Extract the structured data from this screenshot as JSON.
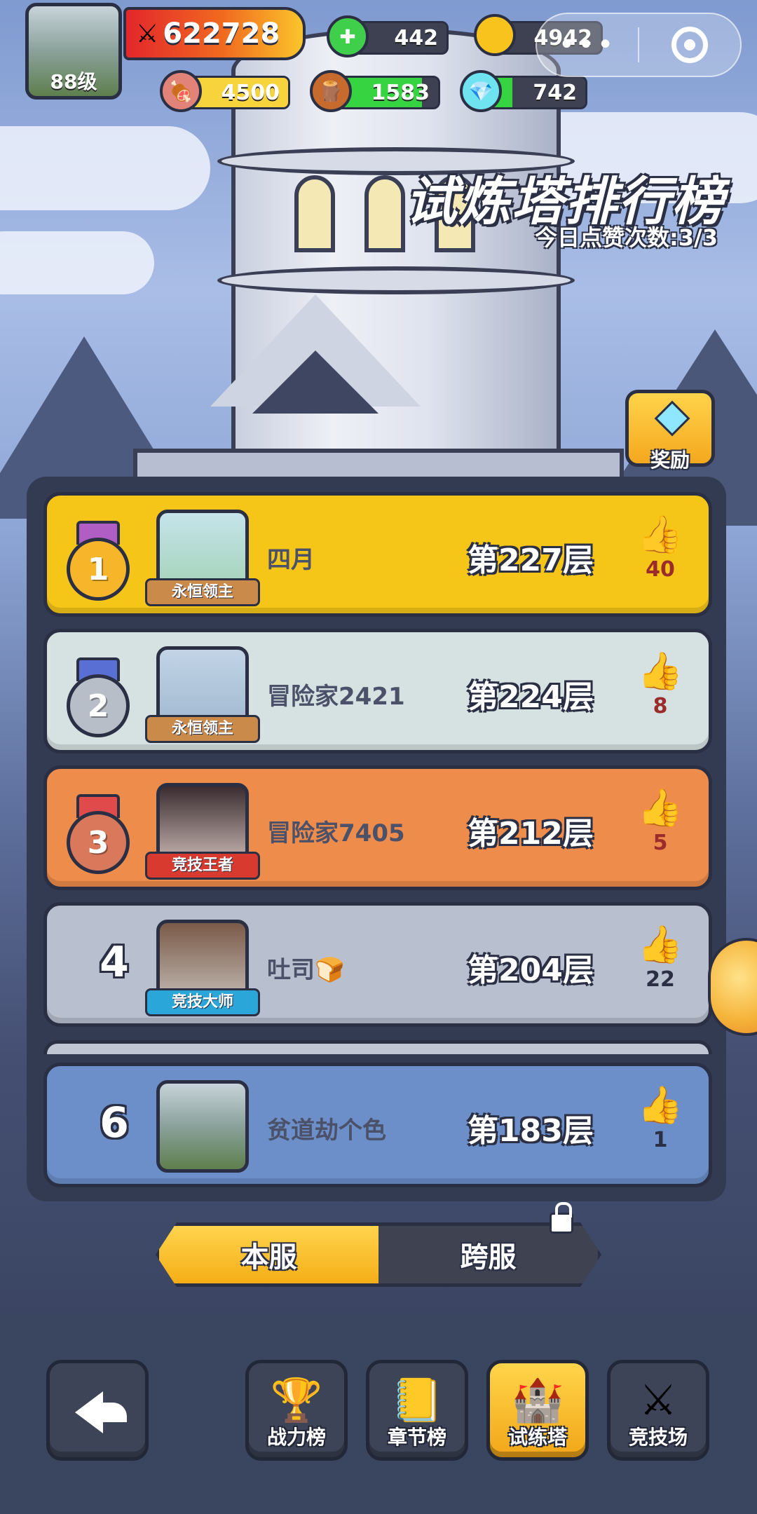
{
  "player": {
    "level": "88级",
    "power": "622728"
  },
  "resources": {
    "gems": "442",
    "gold": "4942",
    "meat": "4500",
    "wood": "1583",
    "crystal": "742"
  },
  "capsule": {
    "menu_dots": "•••"
  },
  "header": {
    "title": "试炼塔排行榜",
    "likes_today": "今日点赞次数:3/3",
    "reward_label": "奖励"
  },
  "rankings": [
    {
      "rank": "1",
      "name": "四月",
      "floor": "第227层",
      "likes": "40",
      "badge": "永恒领主"
    },
    {
      "rank": "2",
      "name": "冒险家2421",
      "floor": "第224层",
      "likes": "8",
      "badge": "永恒领主"
    },
    {
      "rank": "3",
      "name": "冒险家7405",
      "floor": "第212层",
      "likes": "5",
      "badge": "竞技王者"
    },
    {
      "rank": "4",
      "name": "吐司🍞",
      "floor": "第204层",
      "likes": "22",
      "badge": "竞技大师"
    }
  ],
  "my_rank": {
    "rank": "6",
    "name": "贫道劫个色",
    "floor": "第183层",
    "likes": "1"
  },
  "tabs": {
    "local": "本服",
    "cross": "跨服"
  },
  "bottom_nav": [
    {
      "label": "",
      "icon": "back-arrow-icon"
    },
    {
      "label": "战力榜",
      "icon": "trophy-icon"
    },
    {
      "label": "章节榜",
      "icon": "book-icon"
    },
    {
      "label": "试练塔",
      "icon": "tower-icon"
    },
    {
      "label": "竞技场",
      "icon": "crossed-swords-icon"
    }
  ],
  "colors": {
    "gold_row": "#f5c518",
    "silver_row": "#d6e2e2",
    "bronze_row": "#ee8c4c",
    "plain_row": "#b8bfce",
    "self_row": "#6c8fca",
    "outline": "#2a2f44"
  }
}
